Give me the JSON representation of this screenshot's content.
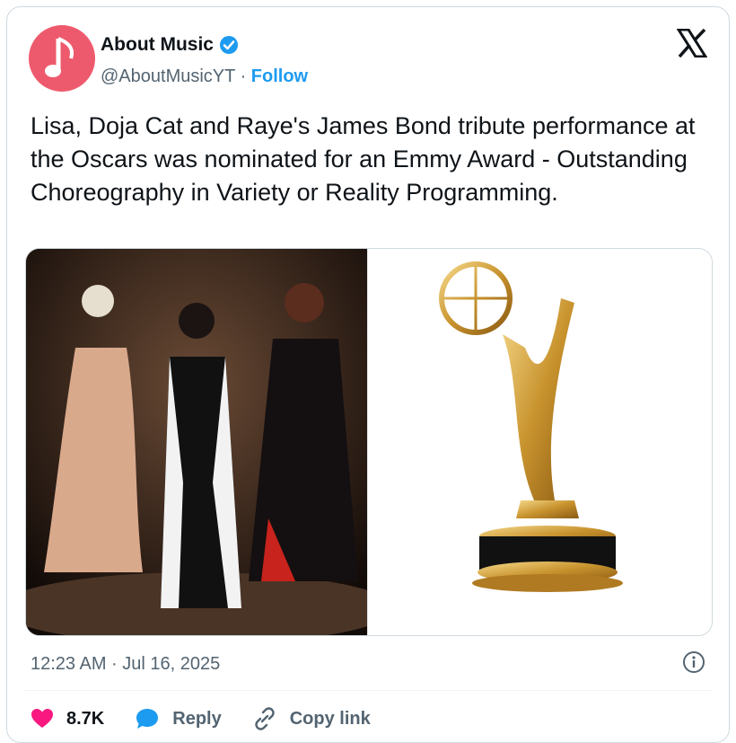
{
  "author": {
    "name": "About Music",
    "handle": "@AboutMusicYT",
    "separator": "·",
    "follow_label": "Follow",
    "avatar_icon": "music-note-icon",
    "avatar_color": "#ee5a6d",
    "verified_color": "#1d9bf0"
  },
  "tweet": {
    "text": "Lisa, Doja Cat and Raye's James Bond tribute performance at the Oscars was nominated for an  Emmy Award - Outstanding Choreography in Variety or Reality Programming.",
    "timestamp": "12:23 AM · Jul 16, 2025"
  },
  "actions": {
    "likes": "8.7K",
    "reply_label": "Reply",
    "copy_label": "Copy link"
  },
  "colors": {
    "accent": "#1d9bf0",
    "like": "#f91880",
    "muted": "#536471"
  }
}
